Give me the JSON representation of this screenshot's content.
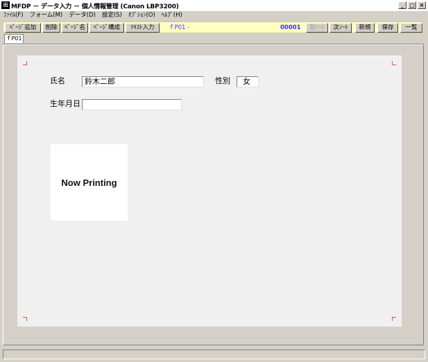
{
  "window": {
    "title": "MFDP － データ入力 － 個人情報管理 (Canon LBP3200)",
    "icon_text": "出",
    "buttons": {
      "minimize": "_",
      "maximize": "□",
      "close": "×"
    }
  },
  "menu": {
    "items": [
      {
        "label": "ﾌｧｲﾙ(F)"
      },
      {
        "label": "フォーム(M)"
      },
      {
        "label": "データ(D)"
      },
      {
        "label": "設定(S)"
      },
      {
        "label": "ｵﾌﾟｼｮﾝ(O)"
      },
      {
        "label": "ﾍﾙﾌﾟ(H)"
      }
    ]
  },
  "toolbar": {
    "add_page": "ﾍﾟｰｼﾞ追加",
    "delete": "削除",
    "page_name": "ﾍﾟｰｼﾞ名",
    "page_structure": "ﾍﾟｰｼﾞ構成",
    "text_input": "ﾃｷｽﾄ入力",
    "current_page": "ｆP01 -",
    "record_number": "00001",
    "prev_note": "前ﾉｰﾄ",
    "next_note": "次ﾉｰﾄ",
    "new": "新規",
    "save": "保存",
    "list": "一覧"
  },
  "tabs": [
    {
      "label": "ｆP01"
    }
  ],
  "form": {
    "name_label": "氏名",
    "name_value": "鈴木二郎",
    "gender_label": "性別",
    "gender_value": "女",
    "birthdate_label": "生年月日",
    "birthdate_value": "",
    "photo_text": "Now Printing"
  },
  "colors": {
    "toolbar_bg": "#ffffc0",
    "page_label": "#3a3aff",
    "corner_marks": "#e05050"
  }
}
